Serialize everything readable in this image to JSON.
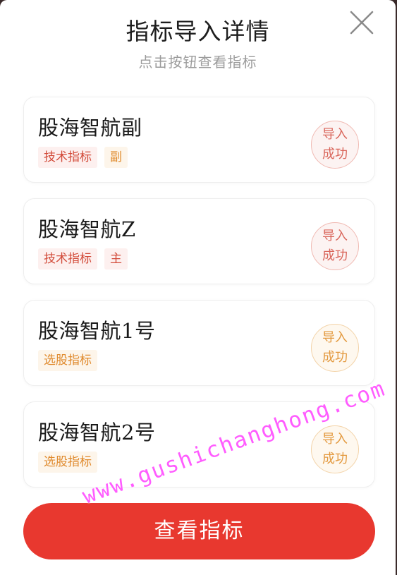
{
  "header": {
    "title": "指标导入详情",
    "subtitle": "点击按钮查看指标"
  },
  "cards": [
    {
      "name": "股海智航副",
      "tags": [
        {
          "label": "技术指标",
          "color": "red"
        },
        {
          "label": "副",
          "color": "orange"
        }
      ],
      "status": [
        "导入",
        "成功"
      ],
      "status_color": "red"
    },
    {
      "name": "股海智航Z",
      "tags": [
        {
          "label": "技术指标",
          "color": "red"
        },
        {
          "label": "主",
          "color": "red"
        }
      ],
      "status": [
        "导入",
        "成功"
      ],
      "status_color": "red"
    },
    {
      "name": "股海智航1号",
      "tags": [
        {
          "label": "选股指标",
          "color": "orange"
        }
      ],
      "status": [
        "导入",
        "成功"
      ],
      "status_color": "orange"
    },
    {
      "name": "股海智航2号",
      "tags": [
        {
          "label": "选股指标",
          "color": "orange"
        }
      ],
      "status": [
        "导入",
        "成功"
      ],
      "status_color": "orange"
    }
  ],
  "button": {
    "label": "查看指标"
  },
  "watermark": "www.gushichanghong.com",
  "colors": {
    "accent": "#e8382f",
    "tag_red": "#d24b3a",
    "tag_orange": "#e08a2d"
  }
}
